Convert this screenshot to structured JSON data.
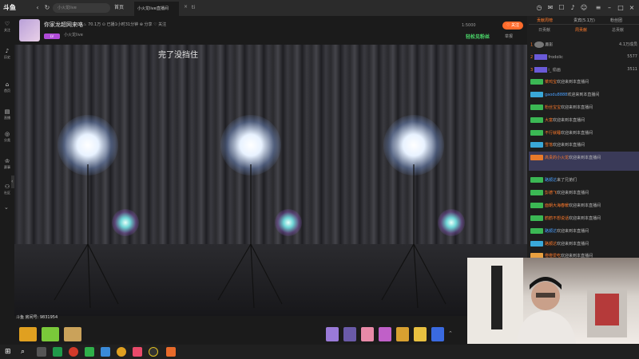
{
  "window": {
    "logo": "斗鱼",
    "back_icon": "‹",
    "refresh_icon": "↻",
    "search_placeholder": "小火龙live",
    "home_tab": "首页",
    "room_tab": "小火龙live直播间",
    "close_glyph": "×",
    "more_tab": "ti"
  },
  "streamer": {
    "room_title": "你家龙超网来咯",
    "stats": "♨ 70.1万  ⊙ 已播1小时31分钟  ⊕ 分享  ♡ 关注",
    "sub_info": "小火龙live",
    "level": "LV",
    "room_number": "1:5000",
    "follow_label": "♡ 关注",
    "fan_tag": "轻松见粉丝",
    "report_label": "举报"
  },
  "video": {
    "caption": "完了没挡住",
    "uid_label": "斗鱼 房间号: 9831954"
  },
  "left_nav": [
    {
      "icon": "♡",
      "label": "关注"
    },
    {
      "icon": "♪",
      "label": "历史"
    },
    {
      "icon": "⌂",
      "label": "首页"
    },
    {
      "icon": "▤",
      "label": "直播"
    },
    {
      "icon": "◎",
      "label": "分类"
    },
    {
      "icon": "♔",
      "label": "赛事"
    },
    {
      "icon": "⚇",
      "label": "社区"
    }
  ],
  "right_panel": {
    "tabs": [
      "贡献周榜",
      "贵宾(5.1万)",
      "粉丝团"
    ],
    "subtabs": [
      "日贡献",
      "周贡献",
      "总贡献"
    ],
    "ranks": [
      {
        "pos": "1",
        "name": "鹿影",
        "value": "4.1万成员"
      },
      {
        "pos": "2",
        "name": "frodolic",
        "value": "5577"
      },
      {
        "pos": "3",
        "name": "i_ 偷画",
        "value": "3511"
      }
    ],
    "chat": [
      {
        "user": "菜鸡宝",
        "text": "欢迎来到本直播间",
        "blue": false
      },
      {
        "user": "gaodu8888",
        "text": "欢迎来到本直播间",
        "blue": true
      },
      {
        "user": "粉丝宝宝",
        "text": "欢迎来到本直播间",
        "blue": false
      },
      {
        "user": "大富",
        "text": "欢迎来到本直播间",
        "blue": false
      },
      {
        "user": "不行就睡",
        "text": "欢迎来到本直播间",
        "blue": false
      },
      {
        "user": "雪落",
        "text": "欢迎来到本直播间",
        "blue": false
      },
      {
        "user": "高贵的小火龙",
        "text": "欢迎来到本直播间",
        "blue": false
      },
      {
        "user": "路顺达",
        "text": "来了兄弟们",
        "blue": true
      },
      {
        "user": "彭德飞",
        "text": "欢迎来到本直播间",
        "blue": false
      },
      {
        "user": "面朝大海春暖",
        "text": "欢迎来到本直播间",
        "blue": false
      },
      {
        "user": "鹤鹤不想说话",
        "text": "欢迎来到本直播间",
        "blue": false
      },
      {
        "user": "路顺达",
        "text": "欢迎来到本直播间",
        "blue": true
      },
      {
        "user": "路顺达",
        "text": "欢迎来到本直播间",
        "blue": false
      },
      {
        "user": "橙橙爱吃",
        "text": "欢迎来到本直播间",
        "blue": false
      }
    ]
  }
}
